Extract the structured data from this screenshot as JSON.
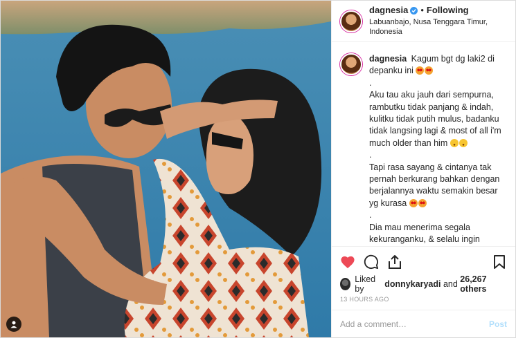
{
  "header": {
    "username": "dagnesia",
    "dot": "•",
    "follow_status": "Following",
    "location": "Labuanbajo, Nusa Tenggara Timur, Indonesia"
  },
  "caption": {
    "username": "dagnesia",
    "lines": [
      "Kagum bgt dg laki2 di depanku ini",
      ".",
      "Aku tau aku jauh dari sempurna, rambutku tidak panjang & indah, kulitku tidak putih mulus, badanku tidak langsing lagi & most of all i'm much older than him",
      ".",
      "Tapi rasa sayang & cintanya tak pernah berkurang bahkan dengan berjalannya waktu semakin besar yg kurasa",
      ".",
      "Dia mau menerima segala kekuranganku, & selalu ingin membahagiakanku"
    ]
  },
  "likes": {
    "prefix": "Liked by",
    "first_user": "donnykaryadi",
    "conjunction": "and",
    "others": "26,267 others"
  },
  "timestamp": "13 HOURS AGO",
  "comment": {
    "placeholder": "Add a comment…",
    "post_label": "Post"
  },
  "colors": {
    "heart": "#ed4956",
    "verified": "#3897f0",
    "post_disabled": "#b2dffc"
  },
  "icons": [
    "heart-icon",
    "comment-icon",
    "share-icon",
    "bookmark-icon",
    "user-tag-icon",
    "verified-badge-icon"
  ]
}
